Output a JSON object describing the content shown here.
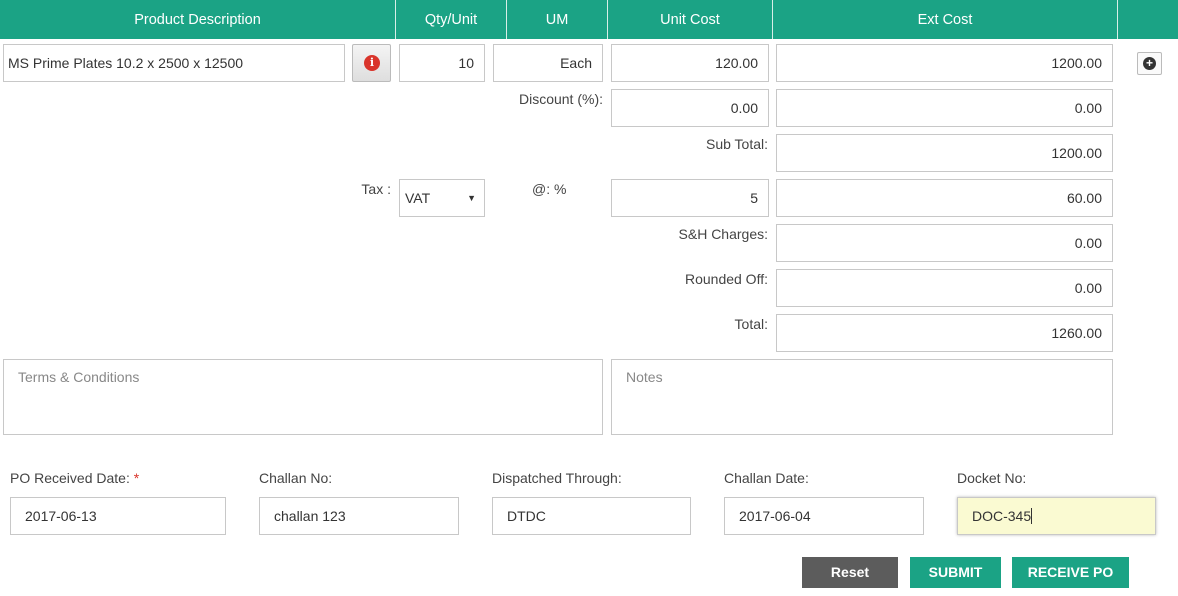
{
  "table_header": {
    "product_description": "Product Description",
    "qty_unit": "Qty/Unit",
    "um": "UM",
    "unit_cost": "Unit Cost",
    "ext_cost": "Ext Cost"
  },
  "line_item": {
    "product": "MS Prime Plates 10.2 x 2500 x 12500",
    "qty": "10",
    "um": "Each",
    "unit_cost": "120.00",
    "ext_cost": "1200.00",
    "info_icon": "info-circle-icon",
    "add_icon": "plus-circle-icon"
  },
  "discount": {
    "label": "Discount (%):",
    "percent": "0.00",
    "amount": "0.00"
  },
  "sub_total": {
    "label": "Sub Total:",
    "value": "1200.00"
  },
  "tax": {
    "label": "Tax :",
    "selected": "VAT",
    "rate_label": "@: %",
    "rate": "5",
    "amount": "60.00"
  },
  "sh_charges": {
    "label": "S&H Charges:",
    "value": "0.00"
  },
  "rounded_off": {
    "label": "Rounded Off:",
    "value": "0.00"
  },
  "total": {
    "label": "Total:",
    "value": "1260.00"
  },
  "terms": {
    "placeholder": "Terms & Conditions"
  },
  "notes": {
    "placeholder": "Notes"
  },
  "receipt": {
    "po_received_label": "PO Received Date:",
    "required_mark": "*",
    "po_received_value": "2017-06-13",
    "challan_no_label": "Challan No:",
    "challan_no_value": "challan 123",
    "dispatched_label": "Dispatched Through:",
    "dispatched_value": "DTDC",
    "challan_date_label": "Challan Date:",
    "challan_date_value": "2017-06-04",
    "docket_label": "Docket No:",
    "docket_value": "DOC-345"
  },
  "buttons": {
    "reset": "Reset",
    "submit": "SUBMIT",
    "receive": "RECEIVE PO"
  },
  "colors": {
    "header_green": "#1ba385",
    "button_green": "#1ba385",
    "reset_gray": "#5c5c5c",
    "active_field_bg": "#fafad2",
    "required_red": "#d9342b"
  }
}
